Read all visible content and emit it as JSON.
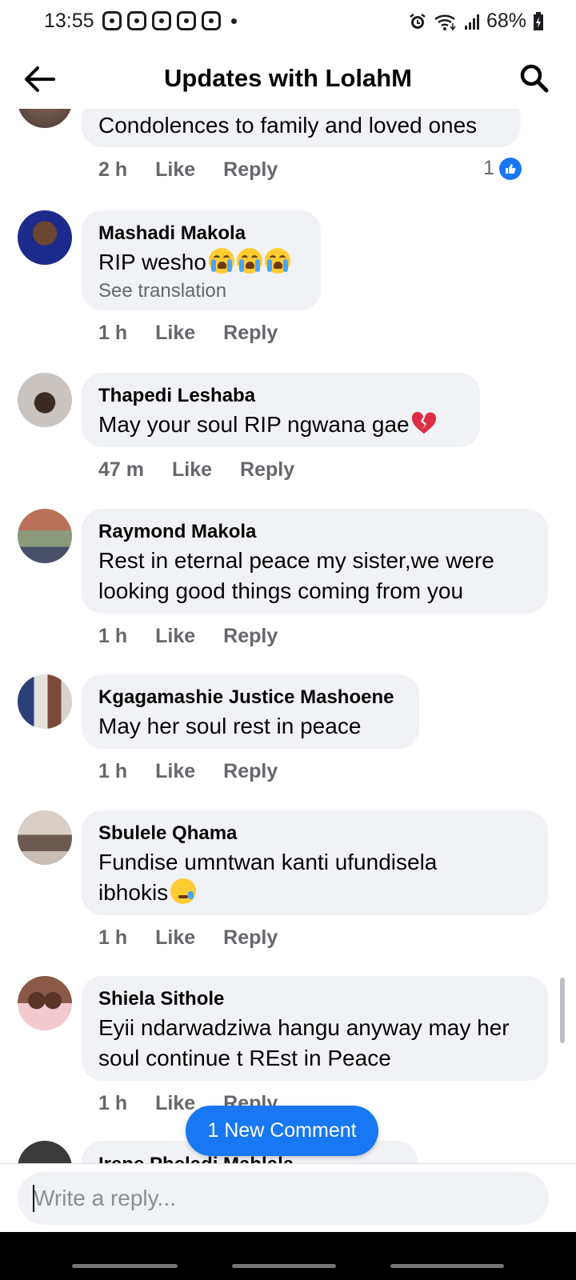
{
  "status_bar": {
    "time": "13:55",
    "battery": "68%"
  },
  "header": {
    "title": "Updates with LolahM"
  },
  "comments": [
    {
      "author": "",
      "text": "Condolences to family and loved ones",
      "time": "2 h",
      "like_label": "Like",
      "reply_label": "Reply",
      "like_count": "1"
    },
    {
      "author": "Mashadi Makola",
      "text": "RIP wesho",
      "emoji": "loudly-crying-face x3",
      "see_translation": "See translation",
      "time": "1 h",
      "like_label": "Like",
      "reply_label": "Reply"
    },
    {
      "author": "Thapedi Leshaba",
      "text": "May your  soul RIP ngwana gae",
      "emoji": "broken-heart",
      "time": "47 m",
      "like_label": "Like",
      "reply_label": "Reply"
    },
    {
      "author": "Raymond Makola",
      "text_lines": [
        "Rest in eternal peace my sister,we were",
        "looking good things coming from you"
      ],
      "time": "1 h",
      "like_label": "Like",
      "reply_label": "Reply"
    },
    {
      "author": "Kgagamashie Justice Mashoene",
      "text": "May her soul rest in peace",
      "time": "1 h",
      "like_label": "Like",
      "reply_label": "Reply"
    },
    {
      "author": "Sbulele Qhama",
      "text_lines": [
        "Fundise umntwan kanti ufundisela",
        "ibhokis"
      ],
      "emoji": "sleepy-face",
      "time": "1 h",
      "like_label": "Like",
      "reply_label": "Reply"
    },
    {
      "author": "Shiela Sithole",
      "text_lines": [
        "Eyii ndarwadziwa hangu anyway may her",
        "soul continue t REst in Peace"
      ],
      "time": "1 h",
      "like_label": "Like",
      "reply_label": "Reply"
    }
  ],
  "partial_next_author": "Irene Pheladi Mahlala",
  "new_comment_button": "1 New Comment",
  "composer": {
    "placeholder": "Write a reply..."
  },
  "colors": {
    "accent": "#1877f2",
    "bubble": "#f0f2f5",
    "meta": "#65676b"
  }
}
